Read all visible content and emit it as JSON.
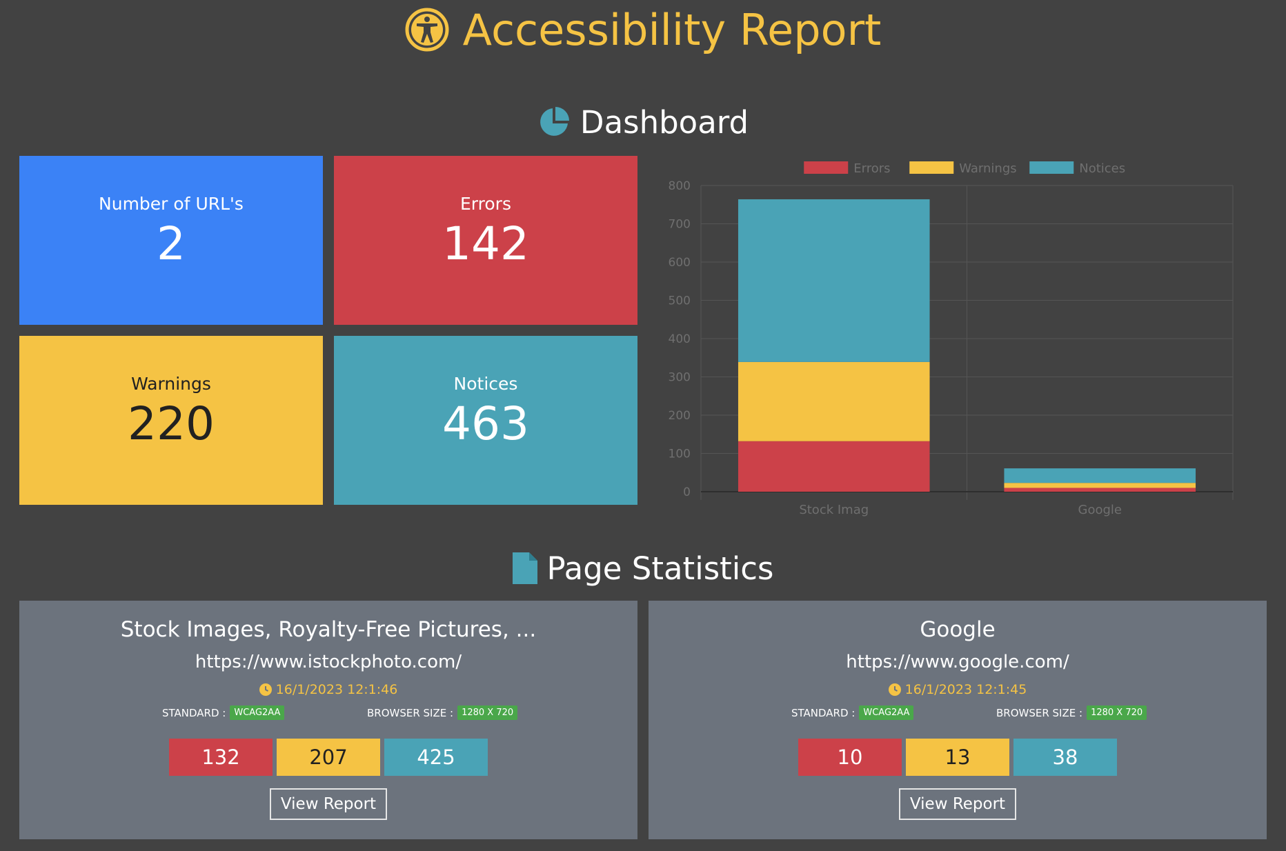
{
  "header": {
    "title": "Accessibility Report"
  },
  "dashboard": {
    "title": "Dashboard",
    "cards": [
      {
        "label": "Number of URL's",
        "value": "2",
        "color": "#3b82f6",
        "text_color": "#ffffff"
      },
      {
        "label": "Errors",
        "value": "142",
        "color": "#cc4149",
        "text_color": "#ffffff"
      },
      {
        "label": "Warnings",
        "value": "220",
        "color": "#f5c344",
        "text_color": "#212121"
      },
      {
        "label": "Notices",
        "value": "463",
        "color": "#4aa3b6",
        "text_color": "#ffffff"
      }
    ]
  },
  "chart_data": {
    "type": "bar",
    "stacked": true,
    "categories": [
      "Stock Imag",
      "Google"
    ],
    "series": [
      {
        "name": "Errors",
        "values": [
          132,
          10
        ],
        "color": "#cc4149"
      },
      {
        "name": "Warnings",
        "values": [
          207,
          13
        ],
        "color": "#f5c344"
      },
      {
        "name": "Notices",
        "values": [
          425,
          38
        ],
        "color": "#4aa3b6"
      }
    ],
    "ylim": [
      0,
      800
    ],
    "yticks": [
      0,
      100,
      200,
      300,
      400,
      500,
      600,
      700,
      800
    ],
    "legend": "top",
    "grid": true
  },
  "page_statistics": {
    "title": "Page Statistics",
    "pages": [
      {
        "title": "Stock Images, Royalty-Free Pictures, ...",
        "url": "https://www.istockphoto.com/",
        "datetime": "16/1/2023 12:1:46",
        "standard_label": "STANDARD :",
        "standard": "WCAG2AA",
        "browser_label": "BROWSER SIZE :",
        "browser_size": "1280 X 720",
        "errors": "132",
        "warnings": "207",
        "notices": "425",
        "button": "View Report"
      },
      {
        "title": "Google",
        "url": "https://www.google.com/",
        "datetime": "16/1/2023 12:1:45",
        "standard_label": "STANDARD :",
        "standard": "WCAG2AA",
        "browser_label": "BROWSER SIZE :",
        "browser_size": "1280 X 720",
        "errors": "10",
        "warnings": "13",
        "notices": "38",
        "button": "View Report"
      }
    ]
  },
  "icons": {
    "header": "accessibility-icon",
    "dashboard": "pie-chart-icon",
    "page_statistics": "file-icon",
    "datetime": "clock-icon"
  }
}
